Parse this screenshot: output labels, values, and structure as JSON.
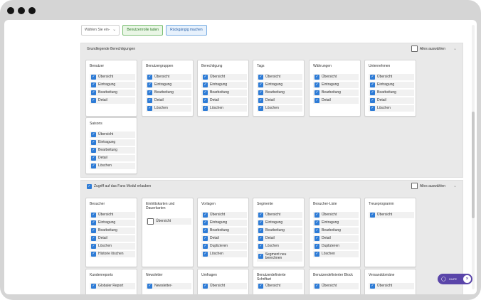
{
  "toolbar": {
    "select_value": "Wählen Sie ein-",
    "load_button": "Benutzerrrolle laden",
    "undo_button": "Rückgängig machen"
  },
  "section1": {
    "title": "Grundlegende Berechtigungen",
    "select_all": "Alles auswählen",
    "cards": [
      {
        "title": "Benutzer",
        "items": [
          "Übersicht",
          "Eintragung",
          "Bearbeitung",
          "Detail"
        ]
      },
      {
        "title": "Benutzergruppen",
        "items": [
          "Übersicht",
          "Eintragung",
          "Bearbeitung",
          "Detail",
          "Löschen"
        ]
      },
      {
        "title": "Berechtigung",
        "items": [
          "Übersicht",
          "Eintragung",
          "Bearbeitung",
          "Detail",
          "Löschen"
        ]
      },
      {
        "title": "Tags",
        "items": [
          "Übersicht",
          "Eintragung",
          "Bearbeitung",
          "Detail",
          "Löschen"
        ]
      },
      {
        "title": "Währungen",
        "items": [
          "Übersicht",
          "Eintragung",
          "Bearbeitung",
          "Detail"
        ]
      },
      {
        "title": "Unternehmen",
        "items": [
          "Übersicht",
          "Eintragung",
          "Bearbeitung",
          "Detail",
          "Löschen"
        ]
      },
      {
        "title": "Saisons",
        "items": [
          "Übersicht",
          "Eintragung",
          "Bearbeitung",
          "Detail",
          "Löschen"
        ]
      }
    ]
  },
  "section2": {
    "title": "Zugriff auf das Fans Modul erlauben",
    "select_all": "Alles auswählen",
    "cards": [
      {
        "title": "Besucher",
        "items": [
          "Übersicht",
          "Eintragung",
          "Bearbeitung",
          "Detail",
          "Löschen",
          "Historie löschen"
        ]
      },
      {
        "title": "Eintrittskarten und Dauerkarten",
        "items": [
          "Übersicht"
        ]
      },
      {
        "title": "Vorlagen",
        "items": [
          "Übersicht",
          "Eintragung",
          "Bearbeitung",
          "Detail",
          "Duplizieren",
          "Löschen"
        ]
      },
      {
        "title": "Segmente",
        "items": [
          "Übersicht",
          "Eintragung",
          "Bearbeitung",
          "Detail",
          "Löschen",
          "Segment neu berechnen"
        ]
      },
      {
        "title": "Besucher-Liste",
        "items": [
          "Übersicht",
          "Eintragung",
          "Bearbeitung",
          "Detail",
          "Duplizieren",
          "Löschen"
        ]
      },
      {
        "title": "Treueprogramm",
        "items": [
          "Übersicht"
        ]
      }
    ]
  },
  "section3": {
    "cards": [
      {
        "title": "Kundenreports",
        "items": [
          "Globaler Report"
        ]
      },
      {
        "title": "Newsletter",
        "items": [
          "Newsletter-"
        ]
      },
      {
        "title": "Umfragen",
        "items": [
          "Übersicht"
        ]
      },
      {
        "title": "Benutzerdefinierte Schriftart",
        "items": [
          "Übersicht"
        ]
      },
      {
        "title": "Benutzerdefinierter Block",
        "items": [
          "Übersicht"
        ]
      },
      {
        "title": "Versanddomäne",
        "items": [
          "Übersicht"
        ]
      }
    ]
  },
  "help": {
    "label": "HILFE"
  },
  "colors": {
    "accent": "#2d7bd6",
    "help": "#5a45a9"
  }
}
